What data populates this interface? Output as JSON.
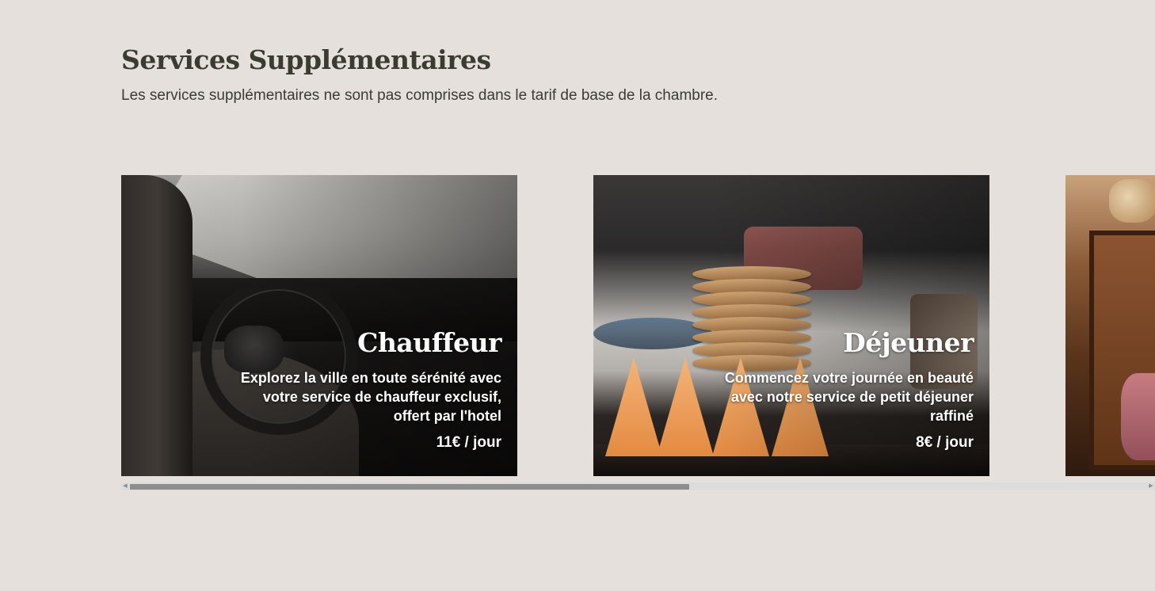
{
  "section": {
    "title": "Services Supplémentaires",
    "subtitle": "Les services supplémentaires ne sont pas comprises dans le tarif de base de la chambre."
  },
  "services": [
    {
      "title": "Chauffeur",
      "description": "Explorez la ville en toute sérénité avec votre service de chauffeur exclusif, offert par l'hotel",
      "price": "11€ / jour",
      "image": "car-interior-photo"
    },
    {
      "title": "Déjeuner",
      "description": "Commencez votre journée en beauté avec notre service de petit déjeuner raffiné",
      "price": "8€ / jour",
      "image": "pancakes-photo"
    },
    {
      "image": "charcuterie-board-photo"
    }
  ],
  "scrollbar": {
    "left_arrow_icon": "caret-left-icon",
    "right_arrow_icon": "caret-right-icon",
    "position_fraction": 0.0,
    "visible_fraction": 0.55
  },
  "colors": {
    "background": "#e5e0dc",
    "text": "#3b3c31",
    "card_text": "#ffffff",
    "scroll_thumb": "#8d8d8d"
  }
}
